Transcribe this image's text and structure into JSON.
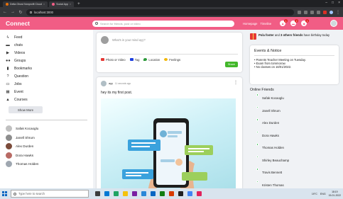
{
  "browser": {
    "tabs": [
      {
        "label": "Delta Ghost Nonprofit Cloud",
        "active": false
      },
      {
        "label": "Social App",
        "active": true
      }
    ],
    "url": "localhost:3000"
  },
  "app": {
    "logo": "Connect",
    "search_placeholder": "Search for friends, post or video",
    "links": [
      "Homepage",
      "Timeline"
    ],
    "notifications": [
      {
        "icon": "person-icon",
        "count": "1"
      },
      {
        "icon": "chat-icon",
        "count": "2"
      },
      {
        "icon": "bell-icon",
        "count": "1"
      }
    ]
  },
  "sidebar": {
    "items": [
      {
        "icon": "rss-icon",
        "glyph": "ϟ",
        "label": "Feed"
      },
      {
        "icon": "chat-icon",
        "glyph": "▬",
        "label": "chats"
      },
      {
        "icon": "play-icon",
        "glyph": "▶",
        "label": "Videos"
      },
      {
        "icon": "group-icon",
        "glyph": "●●",
        "label": "Groups"
      },
      {
        "icon": "bookmark-icon",
        "glyph": "▮",
        "label": "Bookmarks"
      },
      {
        "icon": "help-icon",
        "glyph": "?",
        "label": "Question"
      },
      {
        "icon": "briefcase-icon",
        "glyph": "▭",
        "label": "Jobs"
      },
      {
        "icon": "event-icon",
        "glyph": "▦",
        "label": "Event"
      },
      {
        "icon": "school-icon",
        "glyph": "▲",
        "label": "Courses"
      }
    ],
    "show_more": "Show More",
    "friends": [
      {
        "name": "Safak Kocaoglu",
        "color": "#c0c0c0"
      },
      {
        "name": "Janell Shrum",
        "color": "#8d8d8d"
      },
      {
        "name": "Alex Durden",
        "color": "#7b4b3a"
      },
      {
        "name": "Dora Hawks",
        "color": "#b86a64"
      },
      {
        "name": "Thomas Holden",
        "color": "#9fa7b0"
      }
    ]
  },
  "share": {
    "placeholder": "What's in your mind ayy?",
    "options": [
      {
        "label": "Photo or Video",
        "color": "#e53935"
      },
      {
        "label": "Tag",
        "color": "#1e40e0"
      },
      {
        "label": "Location",
        "color": "#2e9a3c"
      },
      {
        "label": "Feelings",
        "color": "#f2b705"
      }
    ],
    "button": "Share"
  },
  "post": {
    "author": "ayy",
    "date": "11 seconds ago",
    "text": "hey its my first post."
  },
  "rightbar": {
    "birthday": {
      "name": "Pola foster",
      "rest": " and ",
      "others": "3 others friends",
      "suffix": " have birthday today"
    },
    "events_title": "Events & Notice",
    "events": [
      "Parents Teacher Meeting on Tuesday.",
      "Exam from tommorow.",
      "No classes on 16/01/2022."
    ],
    "online_title": "Online Friends",
    "online_friends": [
      {
        "name": "Safak Kocaoglu",
        "color": "#c0c0c0"
      },
      {
        "name": "Janell Shrum",
        "color": "#8d8d8d"
      },
      {
        "name": "Alex Durden",
        "color": "#7b4b3a"
      },
      {
        "name": "Dora Hawks",
        "color": "#b86a64"
      },
      {
        "name": "Thomas Holden",
        "color": "#9fa7b0"
      },
      {
        "name": "Shirley Beauchamp",
        "color": "#c7c7c7"
      },
      {
        "name": "Travis Bennett",
        "color": "#5c7fa8"
      },
      {
        "name": "Kristen Thomas",
        "color": "#a2a2a2"
      }
    ]
  },
  "taskbar": {
    "search_placeholder": "Type here to search",
    "temperature": "19°C",
    "language": "ENG",
    "time": "18:19",
    "date": "15-01-2022",
    "apps": [
      "#3d3d3d",
      "#0078d4",
      "#1fa463",
      "#f4c20d",
      "#7a1fa2",
      "#2b88d8",
      "#0a66c2",
      "#107c10",
      "#d83b01",
      "#202020",
      "#4285f4",
      "#e0245e"
    ]
  }
}
